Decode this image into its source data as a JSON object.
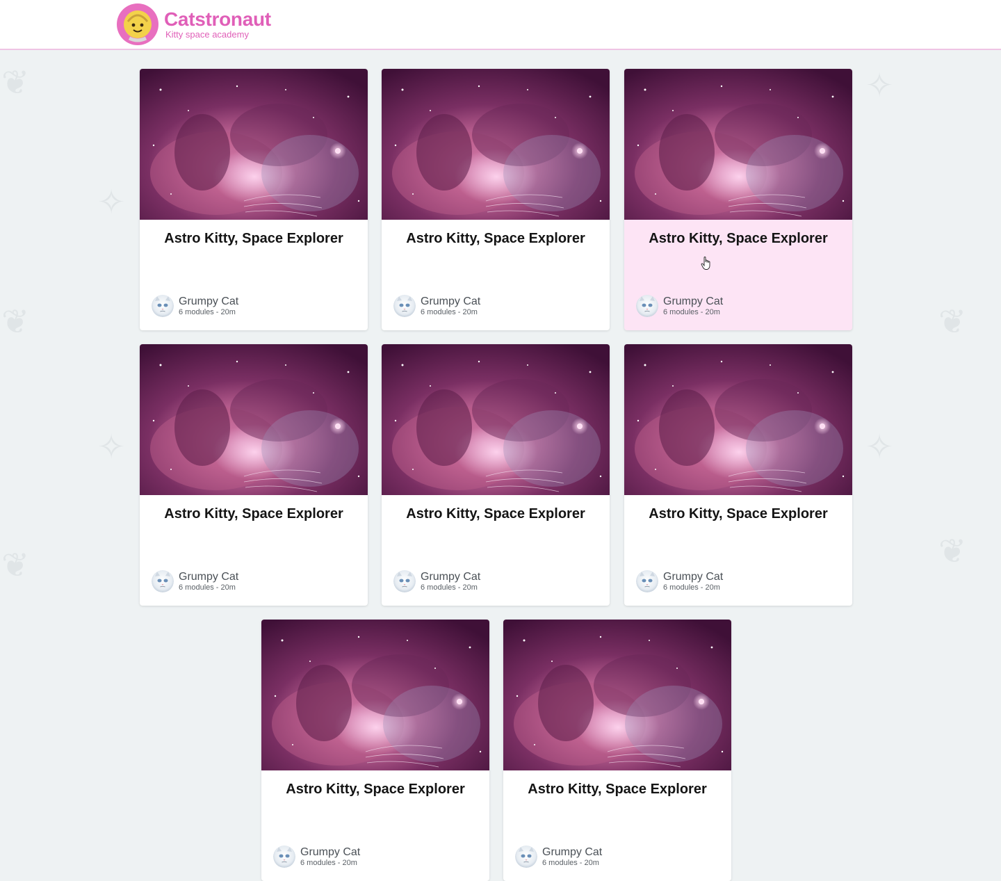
{
  "header": {
    "brand_name": "Catstronaut",
    "tagline": "Kitty space academy",
    "logo_icon": "astronaut-cat-icon"
  },
  "colors": {
    "brand_pink": "#e05fb8",
    "header_border": "#efc3e4",
    "hover_card_bg": "#fde4f5",
    "page_bg": "#eef2f3"
  },
  "tracks": [
    {
      "title": "Astro Kitty, Space Explorer",
      "author": "Grumpy Cat",
      "meta": "6 modules - 20m"
    },
    {
      "title": "Astro Kitty, Space Explorer",
      "author": "Grumpy Cat",
      "meta": "6 modules - 20m"
    },
    {
      "title": "Astro Kitty, Space Explorer",
      "author": "Grumpy Cat",
      "meta": "6 modules - 20m"
    },
    {
      "title": "Astro Kitty, Space Explorer",
      "author": "Grumpy Cat",
      "meta": "6 modules - 20m"
    },
    {
      "title": "Astro Kitty, Space Explorer",
      "author": "Grumpy Cat",
      "meta": "6 modules - 20m"
    },
    {
      "title": "Astro Kitty, Space Explorer",
      "author": "Grumpy Cat",
      "meta": "6 modules - 20m"
    },
    {
      "title": "Astro Kitty, Space Explorer",
      "author": "Grumpy Cat",
      "meta": "6 modules - 20m"
    },
    {
      "title": "Astro Kitty, Space Explorer",
      "author": "Grumpy Cat",
      "meta": "6 modules - 20m"
    }
  ]
}
